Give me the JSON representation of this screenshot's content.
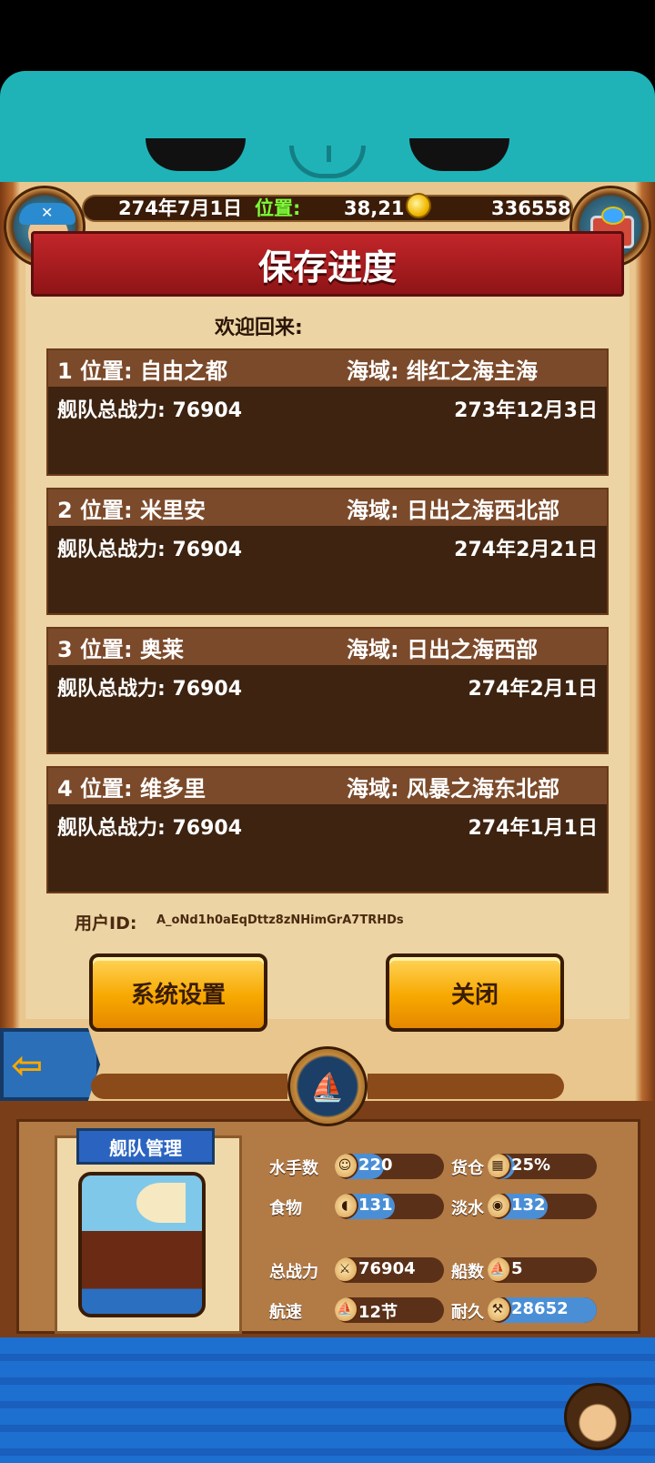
{
  "status": {
    "date": "274年7月1日",
    "position_label": "位置:",
    "position_value": "38,21",
    "gold": "336558"
  },
  "dialog": {
    "title": "保存进度",
    "welcome": "欢迎回来:",
    "slots": [
      {
        "location": "1 位置: 自由之都",
        "sea": "海域: 绯红之海主海",
        "power": "舰队总战力:  76904",
        "date": "273年12月3日"
      },
      {
        "location": "2 位置: 米里安",
        "sea": "海域: 日出之海西北部",
        "power": "舰队总战力:  76904",
        "date": "274年2月21日"
      },
      {
        "location": "3 位置: 奥莱",
        "sea": "海域: 日出之海西部",
        "power": "舰队总战力:  76904",
        "date": "274年2月1日"
      },
      {
        "location": "4 位置: 维多里",
        "sea": "海域: 风暴之海东北部",
        "power": "舰队总战力:  76904",
        "date": "274年1月1日"
      }
    ],
    "user_id_label": "用户ID:",
    "user_id": "A_oNd1h0aEqDttz8zNHimGrA7TRHDs",
    "settings_button": "系统设置",
    "close_button": "关闭"
  },
  "fleet": {
    "title": "舰队管理",
    "sailors_label": "水手数",
    "sailors_value": "220",
    "cargo_label": "货仓",
    "cargo_value": "25%",
    "food_label": "食物",
    "food_value": "131",
    "water_label": "淡水",
    "water_value": "132",
    "power_label": "总战力",
    "power_value": "76904",
    "ships_label": "船数",
    "ships_value": "5",
    "speed_label": "航速",
    "speed_value": "12节",
    "durability_label": "耐久",
    "durability_value": "28652"
  },
  "fills": {
    "sailors": 0.45,
    "cargo": 0.25,
    "food": 0.55,
    "water": 0.55,
    "durability": 1.0
  },
  "icons": [
    "back-arrow-icon",
    "ship-wheel-icon",
    "coin-icon",
    "treasure-chest-icon",
    "captain-avatar-icon"
  ],
  "colors": {
    "accent": "#f7a800",
    "title_red": "#c2262a",
    "teal": "#1fb3b8",
    "slot_bg": "#3d2310"
  }
}
